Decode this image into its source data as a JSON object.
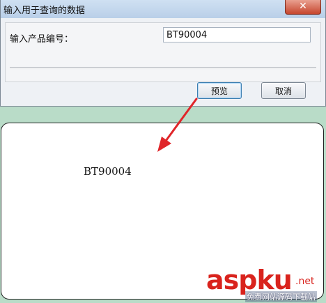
{
  "window": {
    "title": "输入用于查询的数据",
    "close_glyph": "✕"
  },
  "prompt": {
    "label": "输入产品编号：",
    "value": "BT90004"
  },
  "buttons": {
    "preview_label": "预览",
    "cancel_label": "取消"
  },
  "preview": {
    "text": "BT90004"
  },
  "watermark": {
    "brand": "aspku",
    "domain": ".net",
    "caption": "免费网站源码下载站"
  },
  "colors": {
    "arrow": "#e0262a",
    "brand": "#d9231d",
    "background": "#b9dcc8"
  }
}
